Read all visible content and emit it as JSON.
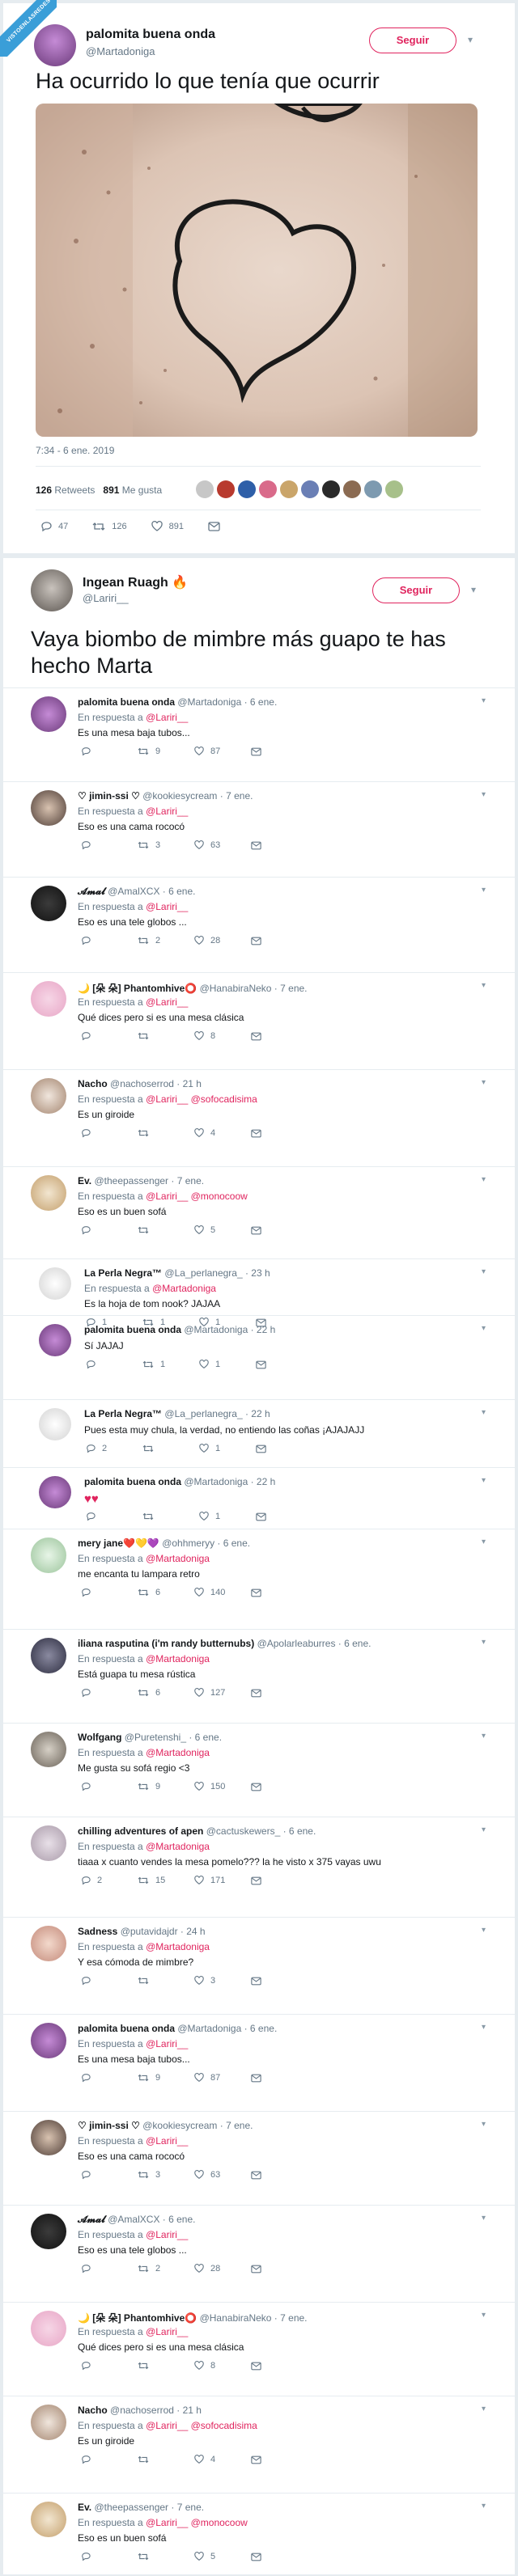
{
  "badge": {
    "text": "VISTOENLASREDES"
  },
  "tweet1": {
    "name": "palomita buena onda",
    "handle": "@Martadoniga",
    "follow_label": "Seguir",
    "text": "Ha ocurrido lo que tenía que ocurrir",
    "timestamp": "7:34 - 6 ene. 2019",
    "retweets_count": "126",
    "retweets_label": "Retweets",
    "likes_count": "891",
    "likes_label": "Me gusta",
    "actions": {
      "replies": "47",
      "retweets": "126",
      "likes": "891"
    }
  },
  "tweet2": {
    "name": "Ingean Ruagh",
    "handle": "@Lariri__",
    "follow_label": "Seguir",
    "text_line1": "Vaya biombo de mimbre más guapo te has",
    "text_line2": "hecho Marta"
  },
  "in_reply_label": "En respuesta a",
  "replies": [
    {
      "name": "palomita buena onda",
      "handle": "@Martadoniga · 6 ene.",
      "to": "@Lariri__",
      "to2": "",
      "text": "Es una mesa baja tubos...",
      "r": "",
      "rt": "9",
      "lk": "87"
    },
    {
      "name": "♡ jimin-ssi ♡",
      "handle": "@kookiesycream · 7 ene.",
      "to": "@Lariri__",
      "to2": "",
      "text": "Eso es una cama rococó",
      "r": "",
      "rt": "3",
      "lk": "63"
    },
    {
      "name": "𝓐𝓶𝓪𝓵",
      "handle": "@AmalXCX · 6 ene.",
      "to": "@Lariri__",
      "to2": "",
      "text": "Eso es una tele globos ...",
      "r": "",
      "rt": "2",
      "lk": "28"
    },
    {
      "name": "🌙 [朵 朵] Phantomhive⭕",
      "handle": "@HanabiraNeko · 7 ene.",
      "to": "@Lariri__",
      "to2": "",
      "text": "Qué dices pero si es una mesa clásica",
      "r": "",
      "rt": "",
      "lk": "8"
    },
    {
      "name": "Nacho",
      "handle": "@nachoserrod · 21 h",
      "to": "@Lariri__",
      "to2": "@sofocadisima",
      "text": "Es un giroide",
      "r": "",
      "rt": "",
      "lk": "4"
    },
    {
      "name": "Ev.",
      "handle": "@theepassenger · 7 ene.",
      "to": "@Lariri__",
      "to2": "@monocoow",
      "text": "Eso es un buen sofá",
      "r": "",
      "rt": "",
      "lk": "5"
    },
    {
      "name": "La Perla Negra™",
      "handle": "@La_perlanegra_ · 23 h",
      "to": "@Martadoniga",
      "to2": "",
      "text": "Es la hoja de tom nook? JAJAA",
      "r": "1",
      "rt": "1",
      "lk": "1"
    },
    {
      "name": "palomita buena onda",
      "handle": "@Martadoniga · 22 h",
      "to": "",
      "to2": "",
      "text": "Sí JAJAJ",
      "r": "",
      "rt": "1",
      "lk": "1"
    },
    {
      "name": "La Perla Negra™",
      "handle": "@La_perlanegra_ · 22 h",
      "to": "",
      "to2": "",
      "text": "Pues esta muy chula, la verdad, no entiendo las coñas ¡AJAJAJJ",
      "r": "2",
      "rt": "",
      "lk": "1"
    },
    {
      "name": "palomita buena onda",
      "handle": "@Martadoniga · 22 h",
      "to": "",
      "to2": "",
      "text": "♥♥",
      "r": "",
      "rt": "",
      "lk": "1"
    },
    {
      "name": "mery jane❤️💛💜",
      "handle": "@ohhmeryy · 6 ene.",
      "to": "@Martadoniga",
      "to2": "",
      "text": "me encanta tu lampara retro",
      "r": "",
      "rt": "6",
      "lk": "140"
    },
    {
      "name": "iliana rasputina (i'm randy butternubs)",
      "handle": "@Apolarleaburres · 6 ene.",
      "to": "@Martadoniga",
      "to2": "",
      "text": "Está guapa tu mesa rústica",
      "r": "",
      "rt": "6",
      "lk": "127"
    },
    {
      "name": "Wolfgang",
      "handle": "@Puretenshi_ · 6 ene.",
      "to": "@Martadoniga",
      "to2": "",
      "text": "Me gusta su sofá regio <3",
      "r": "",
      "rt": "9",
      "lk": "150"
    },
    {
      "name": "chilling adventures of apen",
      "handle": "@cactuskewers_ · 6 ene.",
      "to": "@Martadoniga",
      "to2": "",
      "text": "tiaaa x cuanto vendes la mesa pomelo??? la he visto x 375 vayas uwu",
      "r": "2",
      "rt": "15",
      "lk": "171"
    },
    {
      "name": "Sadness",
      "handle": "@putavidajdr · 24 h",
      "to": "@Martadoniga",
      "to2": "",
      "text": "Y esa cómoda de mimbre?",
      "r": "",
      "rt": "",
      "lk": "3"
    },
    {
      "name": "palomita buena onda",
      "handle": "@Martadoniga · 6 ene.",
      "to": "@Lariri__",
      "to2": "",
      "text": "Es una mesa baja tubos...",
      "r": "",
      "rt": "9",
      "lk": "87"
    },
    {
      "name": "♡ jimin-ssi ♡",
      "handle": "@kookiesycream · 7 ene.",
      "to": "@Lariri__",
      "to2": "",
      "text": "Eso es una cama rococó",
      "r": "",
      "rt": "3",
      "lk": "63"
    },
    {
      "name": "𝓐𝓶𝓪𝓵",
      "handle": "@AmalXCX · 6 ene.",
      "to": "@Lariri__",
      "to2": "",
      "text": "Eso es una tele globos ...",
      "r": "",
      "rt": "2",
      "lk": "28"
    },
    {
      "name": "🌙 [朵 朵] Phantomhive⭕",
      "handle": "@HanabiraNeko · 7 ene.",
      "to": "@Lariri__",
      "to2": "",
      "text": "Qué dices pero si es una mesa clásica",
      "r": "",
      "rt": "",
      "lk": "8"
    },
    {
      "name": "Nacho",
      "handle": "@nachoserrod · 21 h",
      "to": "@Lariri__",
      "to2": "@sofocadisima",
      "text": "Es un giroide",
      "r": "",
      "rt": "",
      "lk": "4"
    },
    {
      "name": "Ev.",
      "handle": "@theepassenger · 7 ene.",
      "to": "@Lariri__",
      "to2": "@monocoow",
      "text": "Eso es un buen sofá",
      "r": "",
      "rt": "",
      "lk": "5"
    }
  ],
  "colors": {
    "accent": "#e0245e",
    "muted": "#657786",
    "border": "#e6ecf0",
    "badge": "#3a9ed8"
  }
}
